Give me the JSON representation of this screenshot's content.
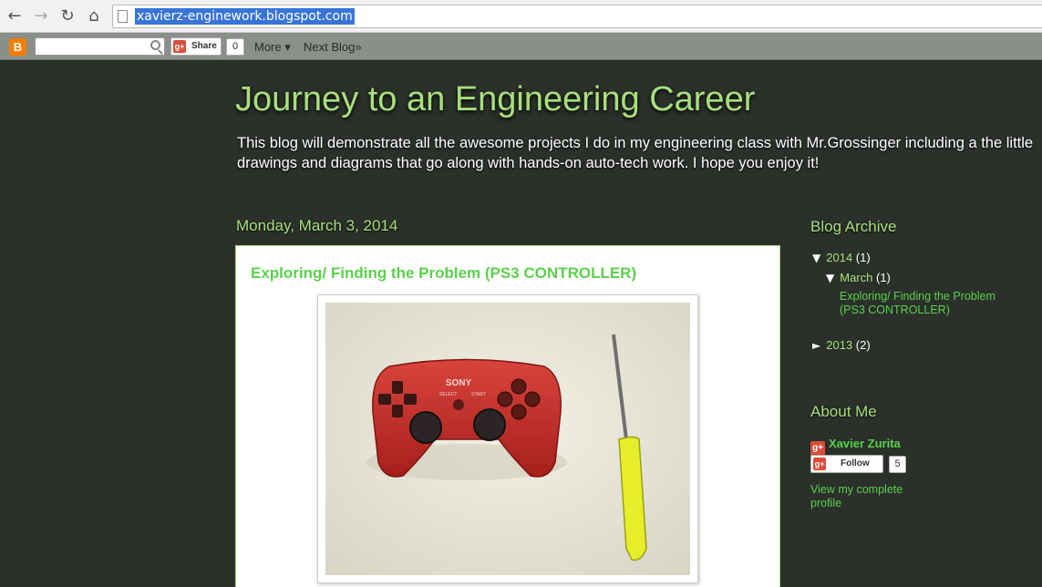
{
  "browser": {
    "url": "xavierz-enginework.blogspot.com",
    "back_icon": "←",
    "forward_icon": "→",
    "reload_icon": "↻",
    "home_icon": "⌂"
  },
  "navbar": {
    "logo": "B",
    "gplus_mini": "g+",
    "share_label": "Share",
    "share_count": "0",
    "more_label": "More ▾",
    "next_blog_label": "Next Blog»"
  },
  "header": {
    "title": "Journey to an Engineering Career",
    "description": "This blog will demonstrate all the awesome projects I do in my engineering class with Mr.Grossinger including a the little drawings and diagrams that go along with hands-on auto-tech work. I hope you enjoy it!"
  },
  "post": {
    "date": "Monday, March 3, 2014",
    "title": "Exploring/ Finding the Problem (PS3 CONTROLLER)",
    "controller_brand": "SONY",
    "select_label": "SELECT",
    "start_label": "START"
  },
  "sidebar": {
    "archive_heading": "Blog Archive",
    "archive": [
      {
        "toggle": "▼",
        "label": "2014",
        "count": "(1)"
      },
      {
        "toggle": "▼",
        "label": "March",
        "count": "(1)"
      },
      {
        "toggle": "►",
        "label": "2013",
        "count": "(2)"
      }
    ],
    "archive_post": "Exploring/ Finding the Problem (PS3 CONTROLLER)",
    "about_heading": "About Me",
    "gplus": "g+",
    "profile_name": "Xavier Zurita",
    "follow_label": "Follow",
    "follow_count": "5",
    "view_profile": "View my complete profile"
  },
  "colors": {
    "background": "#2b302b",
    "heading_green": "#a6e07a",
    "link_green": "#5ad14a",
    "url_highlight": "#3874d8"
  }
}
